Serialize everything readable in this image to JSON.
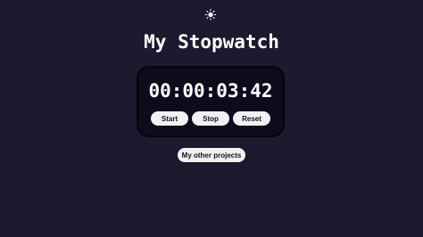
{
  "header": {
    "theme_icon": "sun-icon"
  },
  "title": "My Stopwatch",
  "stopwatch": {
    "time": "00:00:03:42"
  },
  "controls": {
    "start_label": "Start",
    "stop_label": "Stop",
    "reset_label": "Reset"
  },
  "footer": {
    "projects_label": "My other projects"
  },
  "colors": {
    "background": "#1b1a2e",
    "panel": "#0d0c1c",
    "button": "#f1f1f4",
    "text": "#ffffff"
  }
}
